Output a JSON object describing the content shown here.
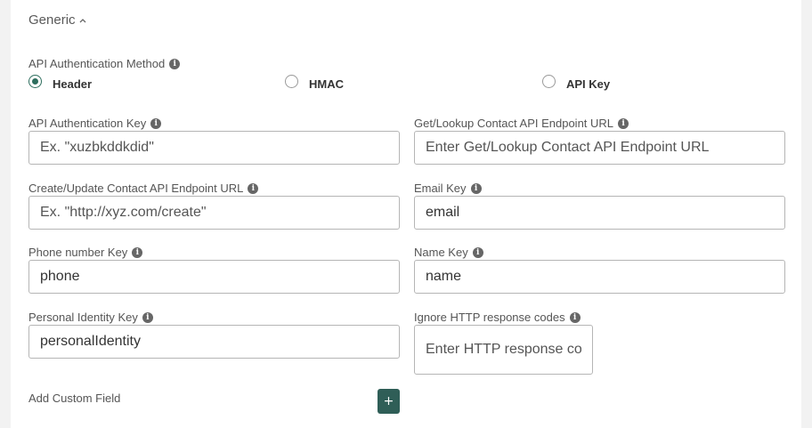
{
  "section": {
    "title": "Generic"
  },
  "auth_method": {
    "label": "API Authentication Method",
    "options": [
      {
        "label": "Header",
        "selected": true
      },
      {
        "label": "HMAC",
        "selected": false
      },
      {
        "label": "API Key",
        "selected": false
      }
    ]
  },
  "fields": {
    "auth_key": {
      "label": "API Authentication Key",
      "value": "",
      "placeholder": "Ex. \"xuzbkddkdid\""
    },
    "lookup_url": {
      "label": "Get/Lookup Contact API Endpoint URL",
      "value": "",
      "placeholder": "Enter Get/Lookup Contact API Endpoint URL"
    },
    "create_url": {
      "label": "Create/Update Contact API Endpoint URL",
      "value": "",
      "placeholder": "Ex. \"http://xyz.com/create\""
    },
    "email_key": {
      "label": "Email Key",
      "value": "email",
      "placeholder": ""
    },
    "phone_key": {
      "label": "Phone number Key",
      "value": "phone",
      "placeholder": ""
    },
    "name_key": {
      "label": "Name Key",
      "value": "name",
      "placeholder": ""
    },
    "identity_key": {
      "label": "Personal Identity Key",
      "value": "personalIdentity",
      "placeholder": ""
    },
    "ignore_codes": {
      "label": "Ignore HTTP response codes",
      "value": "",
      "placeholder": "Enter HTTP response codes"
    }
  },
  "custom_field": {
    "label": "Add Custom Field",
    "button": "+"
  },
  "colors": {
    "accent": "#2f5e57",
    "radio_selected": "#2e6e5e"
  }
}
